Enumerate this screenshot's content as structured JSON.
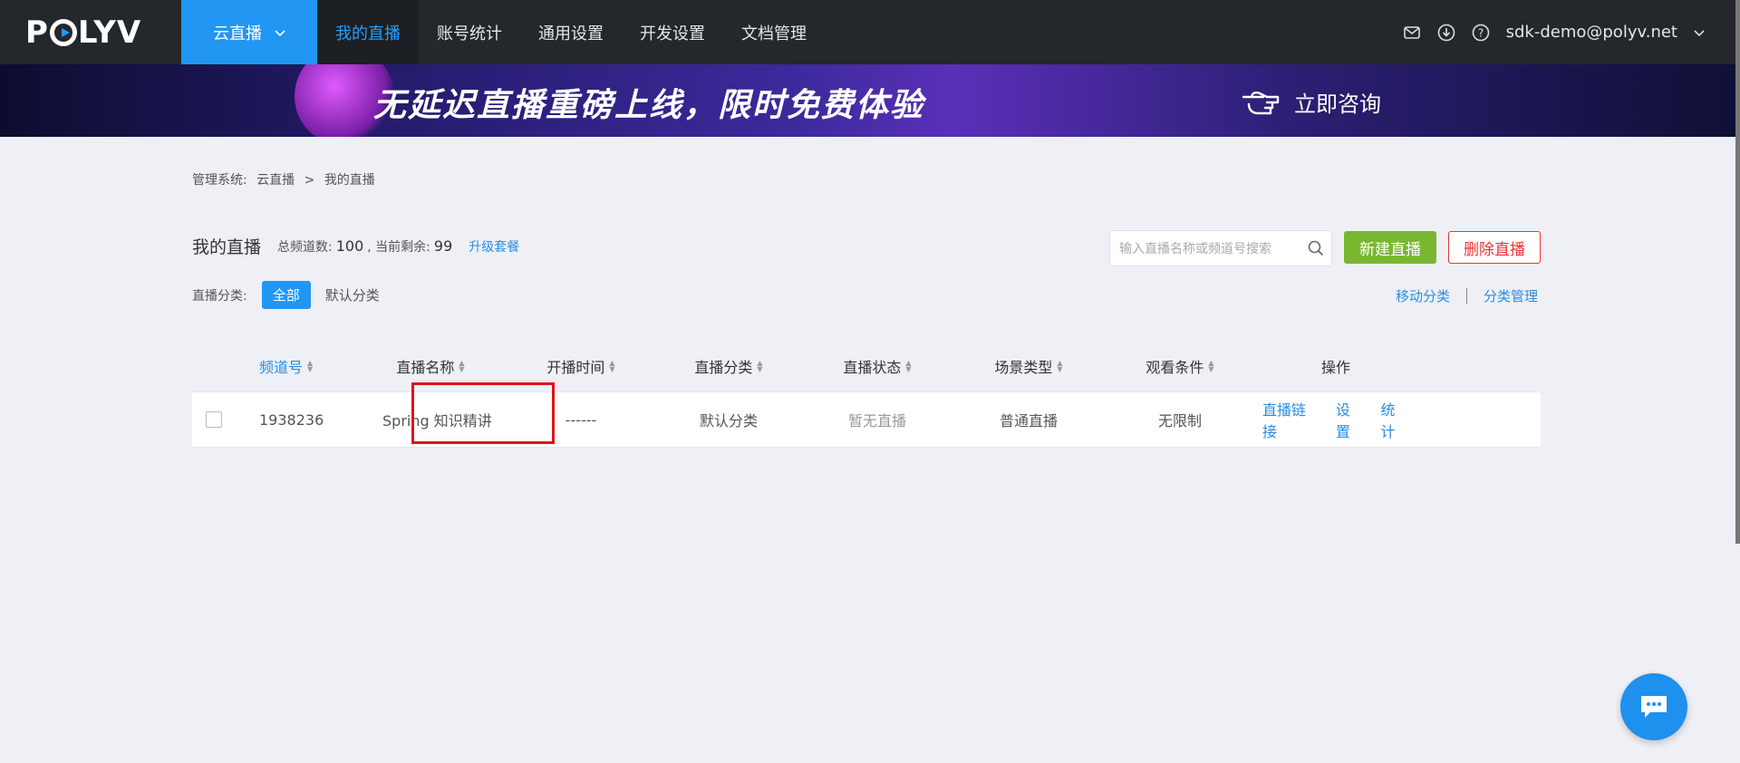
{
  "brand": {
    "logo_text": "POLYV"
  },
  "header": {
    "product": "云直播",
    "nav": [
      {
        "label": "我的直播",
        "active": true
      },
      {
        "label": "账号统计",
        "active": false
      },
      {
        "label": "通用设置",
        "active": false
      },
      {
        "label": "开发设置",
        "active": false
      },
      {
        "label": "文档管理",
        "active": false
      }
    ],
    "user": "sdk-demo@polyv.net"
  },
  "banner": {
    "headline": "无延迟直播重磅上线，限时免费体验",
    "cta": "立即咨询"
  },
  "breadcrumb": {
    "root": "管理系统:",
    "level1": "云直播",
    "sep": ">",
    "level2": "我的直播"
  },
  "summary": {
    "title": "我的直播",
    "total_label": "总频道数:",
    "total_value": "100",
    "remain_label": ", 当前剩余:",
    "remain_value": "99",
    "upgrade": "升级套餐"
  },
  "search": {
    "placeholder": "输入直播名称或频道号搜索"
  },
  "actions": {
    "new": "新建直播",
    "delete": "删除直播"
  },
  "category": {
    "label": "直播分类:",
    "all": "全部",
    "default": "默认分类",
    "move": "移动分类",
    "manage": "分类管理"
  },
  "table": {
    "headers": [
      "频道号",
      "直播名称",
      "开播时间",
      "直播分类",
      "直播状态",
      "场景类型",
      "观看条件",
      "操作"
    ],
    "rows": [
      {
        "channel": "1938236",
        "name": "Spring 知识精讲",
        "start_time": "------",
        "category": "默认分类",
        "status": "暂无直播",
        "scene": "普通直播",
        "condition": "无限制",
        "ops": [
          "直播链接",
          "设置",
          "统计"
        ]
      }
    ]
  },
  "colors": {
    "primary": "#2196f3",
    "green": "#7ab730",
    "danger": "#e33333",
    "highlight": "#e3121b"
  }
}
